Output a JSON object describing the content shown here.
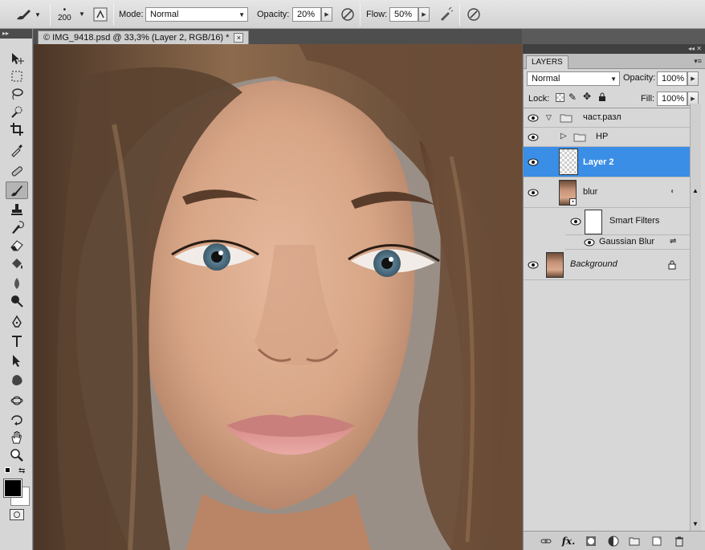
{
  "options": {
    "brush_size": "200",
    "mode_label": "Mode:",
    "mode_value": "Normal",
    "opacity_label": "Opacity:",
    "opacity_value": "20%",
    "flow_label": "Flow:",
    "flow_value": "50%"
  },
  "document": {
    "tab_title": "© IMG_9418.psd @ 33,3% (Layer 2, RGB/16) *",
    "close_glyph": "×"
  },
  "layers": {
    "tab_label": "LAYERS",
    "blend_mode": "Normal",
    "opacity_label": "Opacity:",
    "opacity_value": "100%",
    "lock_label": "Lock:",
    "fill_label": "Fill:",
    "fill_value": "100%",
    "items": [
      {
        "name": "част.разл",
        "type": "group",
        "expanded": true
      },
      {
        "name": "HP",
        "type": "group",
        "expanded": false
      },
      {
        "name": "Layer 2",
        "type": "layer",
        "selected": true
      },
      {
        "name": "blur",
        "type": "smart-object"
      },
      {
        "name": "Smart Filters",
        "type": "smart-filters"
      },
      {
        "name": "Gaussian Blur",
        "type": "filter"
      },
      {
        "name": "Background",
        "type": "background",
        "locked": true
      }
    ]
  },
  "colors": {
    "selection": "#3a8ee6",
    "panel_bg": "#d7d7d7",
    "foreground": "#000000",
    "background": "#ffffff"
  },
  "icons": {
    "tools": [
      "move-icon",
      "marquee-icon",
      "lasso-icon",
      "quick-selection-icon",
      "crop-icon",
      "eyedropper-icon",
      "healing-brush-icon",
      "brush-icon",
      "clone-stamp-icon",
      "history-brush-icon",
      "eraser-icon",
      "paint-bucket-icon",
      "blur-tool-icon",
      "dodge-icon",
      "pen-icon",
      "type-icon",
      "path-selection-icon",
      "custom-shape-icon",
      "3d-rotate-icon",
      "3d-orbit-icon",
      "hand-icon",
      "zoom-icon"
    ],
    "footer": [
      "link-icon",
      "fx-icon",
      "mask-icon",
      "adjustment-icon",
      "new-group-icon",
      "new-layer-icon",
      "trash-icon"
    ]
  }
}
